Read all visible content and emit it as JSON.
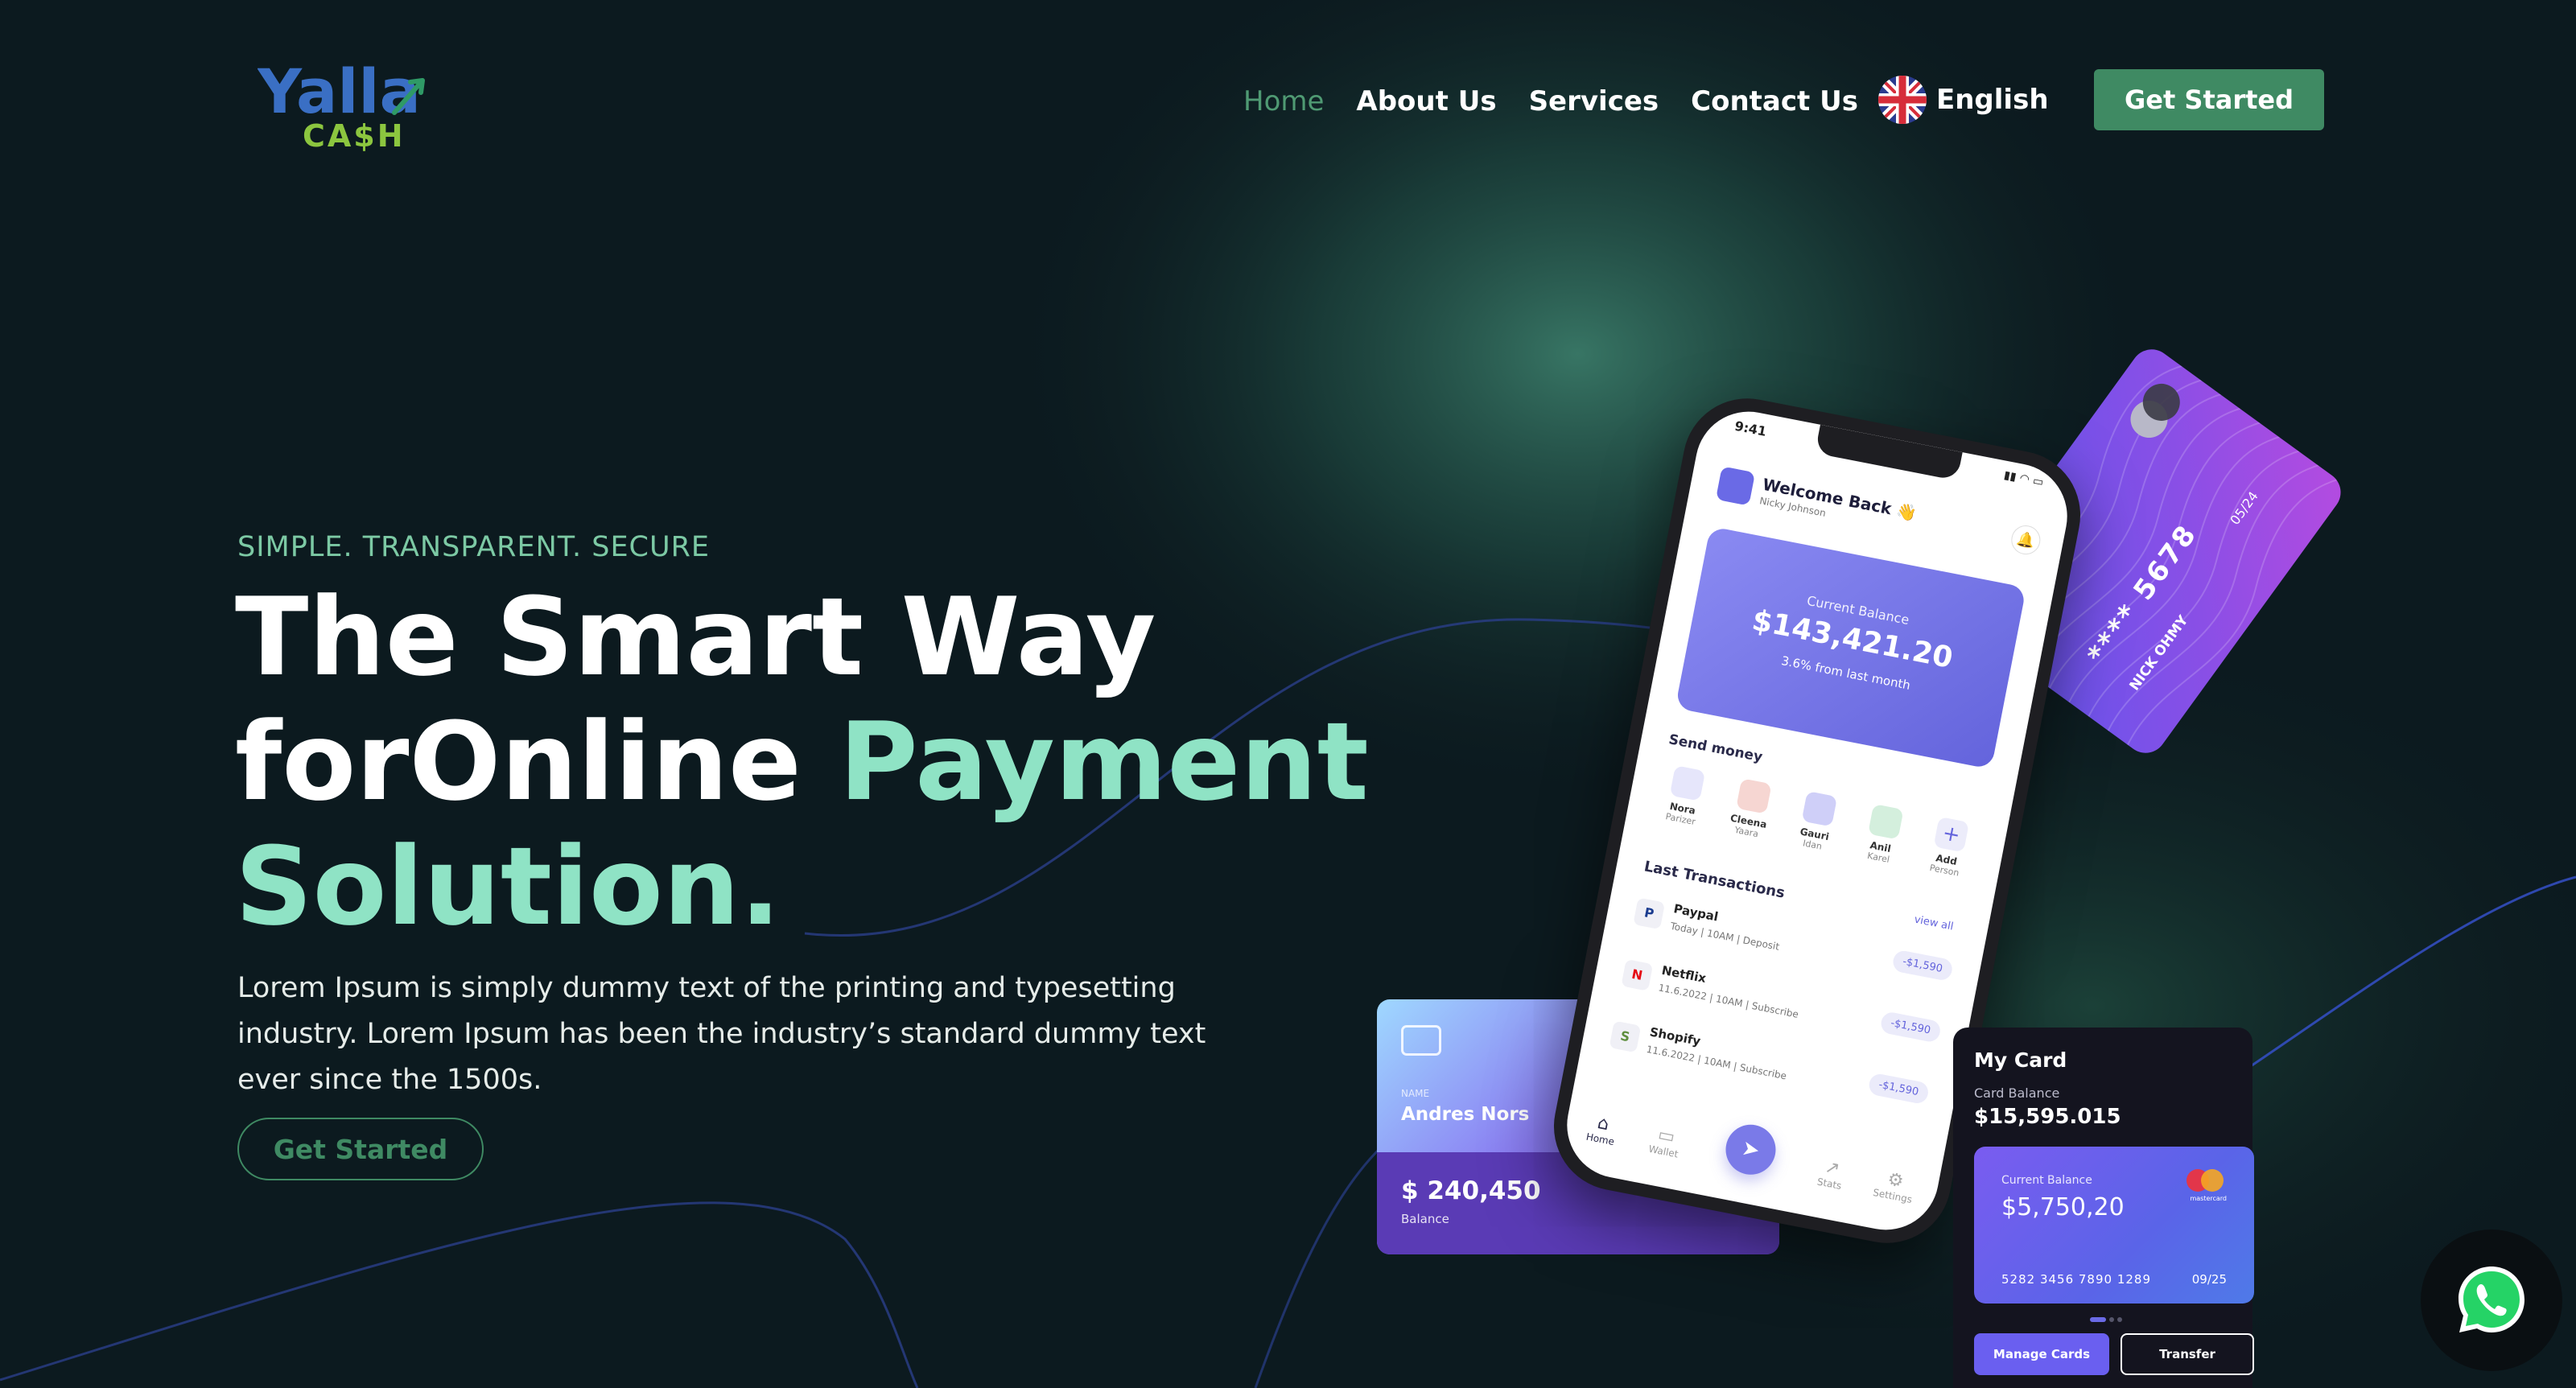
{
  "brand": {
    "logo_text": "Yalla Ca$h",
    "logo_top": "Yalla",
    "logo_bottom": "CA$H"
  },
  "nav": {
    "items": [
      {
        "label": "Home",
        "active": true
      },
      {
        "label": "About Us",
        "active": false
      },
      {
        "label": "Services",
        "active": false
      },
      {
        "label": "Contact Us",
        "active": false
      }
    ],
    "language": {
      "label": "English",
      "icon": "uk-flag-icon"
    },
    "cta_label": "Get Started"
  },
  "hero": {
    "tagline": "SIMPLE. TRANSPARENT. SECURE",
    "title_line1": "The Smart Way",
    "title_line2_white": "forOnline",
    "title_line2_accent": "Payment",
    "title_line3_accent": "Solution.",
    "description": "Lorem Ipsum is simply dummy text of the printing and typesetting industry. Lorem Ipsum has been the industry’s standard dummy text ever since the 1500s.",
    "cta_label": "Get Started"
  },
  "andres_card": {
    "name_caption": "NAME",
    "name": "Andres Nors",
    "amount": "$ 240,450",
    "amount_caption": "Balance"
  },
  "credit_card": {
    "number": "**** 5678",
    "expiry": "05/24",
    "holder": "NICK OHMY"
  },
  "phone_app": {
    "time": "9:41",
    "welcome": "Welcome Back 👋",
    "user": "Nicky Johnson",
    "balance_label": "Current Balance",
    "balance": "$143,421.20",
    "balance_change": "3.6% from last month",
    "send_money_label": "Send money",
    "contacts": [
      {
        "first": "Nora",
        "last": "Parizer",
        "color": "#e6e6fb"
      },
      {
        "first": "Cleena",
        "last": "Yaara",
        "color": "#f6d6d2"
      },
      {
        "first": "Gauri",
        "last": "Idan",
        "color": "#cfcff8"
      },
      {
        "first": "Anil",
        "last": "Karel",
        "color": "#d4efdd"
      }
    ],
    "add_person": {
      "first": "Add",
      "last": "Person"
    },
    "transactions_label": "Last Transactions",
    "view_all": "view all",
    "transactions": [
      {
        "name": "Paypal",
        "detail": "Today | 10AM | Deposit",
        "amount": "-$1,590",
        "icon": "P"
      },
      {
        "name": "Netflix",
        "detail": "11.6.2022 | 10AM | Subscribe",
        "amount": "-$1,590",
        "icon": "N"
      },
      {
        "name": "Shopify",
        "detail": "11.6.2022 | 10AM | Subscribe",
        "amount": "-$1,590",
        "icon": "S"
      }
    ],
    "bottom_nav": {
      "home": "Home",
      "wallet": "Wallet",
      "stats": "Stats",
      "settings": "Settings"
    }
  },
  "my_card": {
    "title": "My Card",
    "caption": "Card Balance",
    "balance": "$15,595.015",
    "inner_label": "Current Balance",
    "inner_amount": "$5,750,20",
    "card_number": "5282 3456 7890 1289",
    "expiry": "09/25",
    "network": "mastercard",
    "manage_label": "Manage Cards",
    "transfer_label": "Transfer"
  },
  "colors": {
    "background": "#0c1a1f",
    "brand_green": "#3f8a63",
    "accent_mint": "#8fe3c5",
    "glow": "#2f6e5c",
    "purple": "#6a5ff0"
  },
  "whatsapp": {
    "icon": "whatsapp-icon"
  }
}
